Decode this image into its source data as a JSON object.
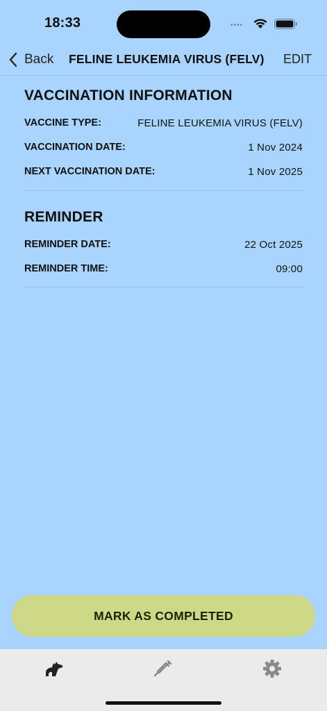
{
  "status_bar": {
    "time": "18:33"
  },
  "nav": {
    "back_label": "Back",
    "title": "FELINE LEUKEMIA VIRUS (FELV)",
    "edit_label": "EDIT"
  },
  "vaccination": {
    "title": "VACCINATION INFORMATION",
    "rows": [
      {
        "label": "VACCINE TYPE:",
        "value": "FELINE LEUKEMIA VIRUS (FELV)"
      },
      {
        "label": "VACCINATION DATE:",
        "value": "1 Nov 2024"
      },
      {
        "label": "NEXT VACCINATION DATE:",
        "value": "1 Nov 2025"
      }
    ]
  },
  "reminder": {
    "title": "REMINDER",
    "rows": [
      {
        "label": "REMINDER DATE:",
        "value": "22 Oct 2025"
      },
      {
        "label": "REMINDER TIME:",
        "value": "09:00"
      }
    ]
  },
  "cta": {
    "label": "MARK AS COMPLETED"
  },
  "tabs": [
    {
      "icon": "pet-icon",
      "active": true
    },
    {
      "icon": "syringe-icon",
      "active": false
    },
    {
      "icon": "gear-icon",
      "active": false
    }
  ],
  "colors": {
    "background": "#a9d4fe",
    "cta": "#cdd986",
    "tab_bar": "#ebebeb",
    "tab_active": "#222222",
    "tab_inactive": "#8a8a8a"
  }
}
